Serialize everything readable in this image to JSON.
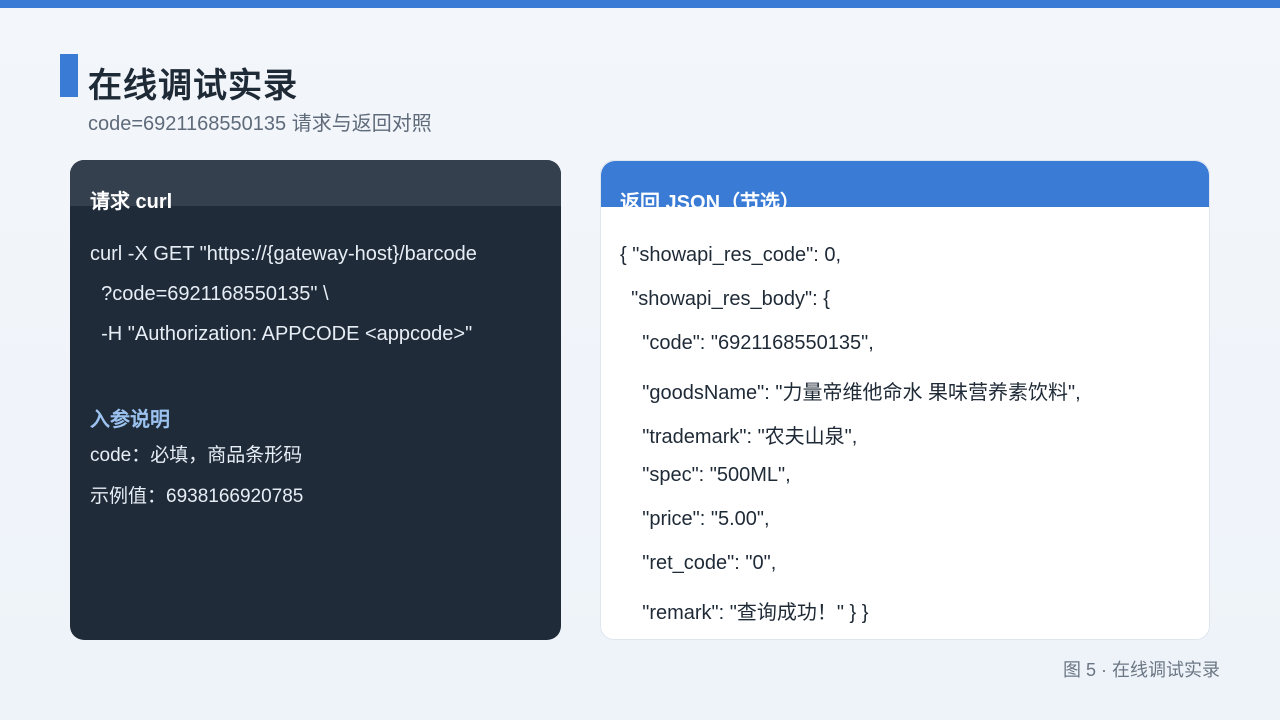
{
  "slide": {
    "title": "在线调试实录",
    "subtitle": "code=6921168550135 请求与返回对照",
    "caption": "图 5 · 在线调试实录"
  },
  "request_panel": {
    "header": "请求 curl",
    "curl_lines": [
      "curl -X GET \"https://{gateway-host}/barcode",
      "  ?code=6921168550135\" \\",
      "  -H \"Authorization: APPCODE <appcode>\""
    ],
    "params_title": "入参说明",
    "params": [
      "code：必填，商品条形码",
      "示例值：6938166920785"
    ]
  },
  "response_panel": {
    "header": "返回 JSON（节选）",
    "json_lines": [
      "{ \"showapi_res_code\": 0,",
      "  \"showapi_res_body\": {",
      "    \"code\": \"6921168550135\",",
      "    \"goodsName\": \"力量帝维他命水 果味营养素饮料\",",
      "    \"trademark\": \"农夫山泉\",",
      "    \"spec\": \"500ML\",",
      "    \"price\": \"5.00\",",
      "    \"ret_code\": \"0\",",
      "    \"remark\": \"查询成功！\" } }"
    ]
  },
  "colors": {
    "accent": "#3a7bd5",
    "dark_panel": "#1f2b39",
    "param_title": "#9cc3f0"
  }
}
